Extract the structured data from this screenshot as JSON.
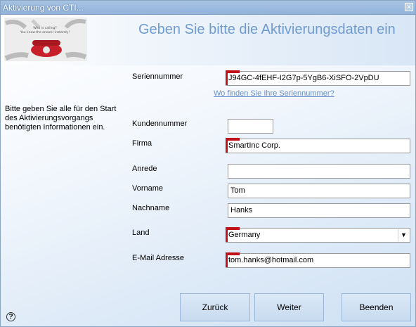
{
  "window": {
    "title": "Aktivierung von CTI..."
  },
  "banner": {
    "caption_line1": "Who is calling?",
    "caption_line2": "You know the answer instantly!"
  },
  "header": {
    "heading": "Geben Sie bitte die Aktivierungsdaten ein"
  },
  "instructions": "Bitte geben Sie alle für den Start des Aktivierungsvorgangs benötigten Informationen ein.",
  "form": {
    "serial_label": "Seriennummer",
    "serial_value": "J94GC-4fEHF-I2G7p-5YgB6-XiSFO-2VpDU",
    "serial_link": "Wo finden Sie Ihre Seriennummer?",
    "customer_label": "Kundennummer",
    "customer_value": "",
    "company_label": "Firma",
    "company_value": "SmartInc Corp.",
    "salutation_label": "Anrede",
    "salutation_value": "",
    "firstname_label": "Vorname",
    "firstname_value": "Tom",
    "lastname_label": "Nachname",
    "lastname_value": "Hanks",
    "country_label": "Land",
    "country_value": "Germany",
    "email_label": "E-Mail Adresse",
    "email_value": "tom.hanks@hotmail.com"
  },
  "buttons": {
    "back": "Zurück",
    "next": "Weiter",
    "finish": "Beenden"
  },
  "icons": {
    "close": "close-icon",
    "help": "help-icon",
    "dropdown": "chevron-down-icon"
  },
  "colors": {
    "heading": "#6f9bd0",
    "required_marker": "#c0101a",
    "link": "#6b8fc6"
  }
}
